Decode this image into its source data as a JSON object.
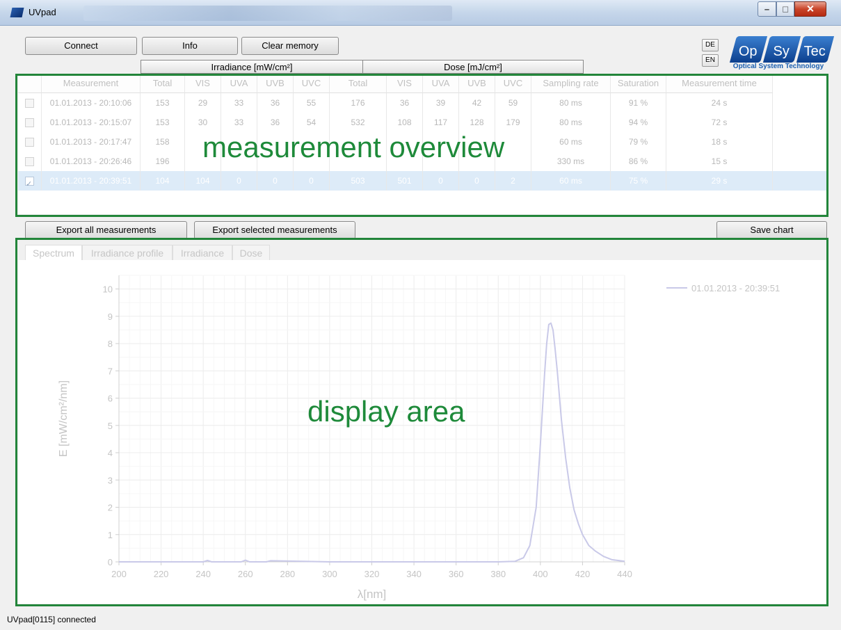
{
  "window": {
    "title": "UVpad"
  },
  "toolbar": {
    "connect": "Connect",
    "info": "Info",
    "clear_memory": "Clear memory"
  },
  "languages": {
    "de": "DE",
    "en": "EN"
  },
  "logo": {
    "op": "Op",
    "sy": "Sy",
    "tec": "Tec",
    "subtitle": "Optical System Technology"
  },
  "groups": {
    "irradiance": "Irradiance [mW/cm²]",
    "dose": "Dose [mJ/cm²]"
  },
  "table": {
    "columns": [
      "",
      "Measurement",
      "Total",
      "VIS",
      "UVA",
      "UVB",
      "UVC",
      "Total",
      "VIS",
      "UVA",
      "UVB",
      "UVC",
      "Sampling rate",
      "Saturation",
      "Measurement time"
    ],
    "rows": [
      {
        "checked": false,
        "cells": [
          "01.01.2013 - 20:10:06",
          "153",
          "29",
          "33",
          "36",
          "55",
          "176",
          "36",
          "39",
          "42",
          "59",
          "80 ms",
          "91 %",
          "24 s"
        ]
      },
      {
        "checked": false,
        "cells": [
          "01.01.2013 - 20:15:07",
          "153",
          "30",
          "33",
          "36",
          "54",
          "532",
          "108",
          "117",
          "128",
          "179",
          "80 ms",
          "94 %",
          "72 s"
        ]
      },
      {
        "checked": false,
        "cells": [
          "01.01.2013 - 20:17:47",
          "158",
          "",
          "",
          "",
          "",
          "",
          "",
          "",
          "",
          "",
          "60 ms",
          "79 %",
          "18 s"
        ]
      },
      {
        "checked": false,
        "cells": [
          "01.01.2013 - 20:26:46",
          "196",
          "",
          "",
          "",
          "",
          "",
          "",
          "",
          "",
          "",
          "330 ms",
          "86 %",
          "15 s"
        ]
      },
      {
        "checked": true,
        "selected": true,
        "cells": [
          "01.01.2013 - 20:39:51",
          "104",
          "104",
          "0",
          "0",
          "0",
          "503",
          "501",
          "0",
          "0",
          "2",
          "60 ms",
          "75 %",
          "29 s"
        ]
      }
    ]
  },
  "overlays": {
    "overview": "measurement overview",
    "display": "display area"
  },
  "actions": {
    "export_all": "Export all measurements",
    "export_selected": "Export selected measurements",
    "save_chart": "Save chart"
  },
  "tabs": [
    "Spectrum",
    "Irradiance profile",
    "Irradiance",
    "Dose"
  ],
  "chart_data": {
    "type": "line",
    "xlabel": "λ[nm]",
    "ylabel": "E [mW/cm²/nm]",
    "xlim": [
      200,
      440
    ],
    "ylim": [
      0,
      10.5
    ],
    "xticks": [
      200,
      220,
      240,
      260,
      280,
      300,
      320,
      340,
      360,
      380,
      400,
      420,
      440
    ],
    "yticks": [
      0,
      1,
      2,
      3,
      4,
      5,
      6,
      7,
      8,
      9,
      10
    ],
    "grid": true,
    "legend_position": "top-right",
    "series": [
      {
        "name": "01.01.2013 - 20:39:51",
        "color": "#c9c9e8",
        "x": [
          200,
          240,
          242,
          244,
          258,
          260,
          262,
          270,
          272,
          300,
          380,
          388,
          392,
          395,
          398,
          400,
          402,
          403,
          404,
          405,
          406,
          407,
          408,
          410,
          412,
          414,
          416,
          418,
          420,
          423,
          426,
          430,
          434,
          440
        ],
        "y": [
          0,
          0,
          0.05,
          0,
          0,
          0.06,
          0,
          0,
          0.04,
          0,
          0,
          0.02,
          0.15,
          0.6,
          2.0,
          4.3,
          6.9,
          8.0,
          8.7,
          8.75,
          8.5,
          7.8,
          7.0,
          5.2,
          3.8,
          2.7,
          1.9,
          1.4,
          1.0,
          0.6,
          0.4,
          0.2,
          0.08,
          0.02
        ]
      }
    ]
  },
  "status": {
    "text": "UVpad[0115] connected"
  }
}
